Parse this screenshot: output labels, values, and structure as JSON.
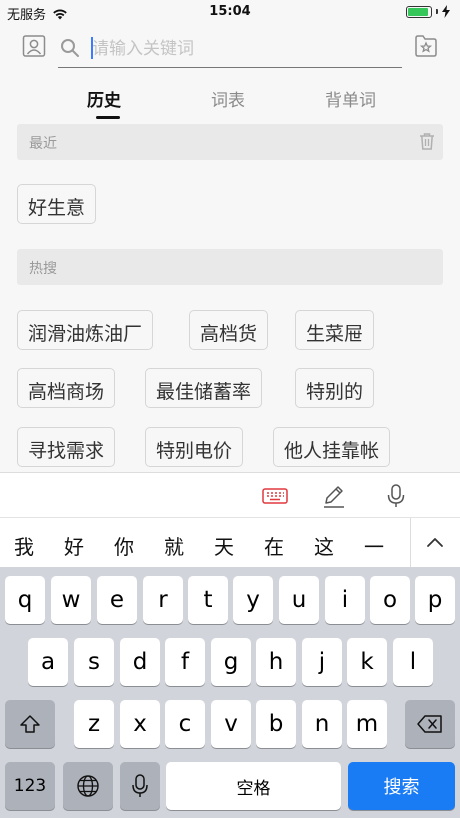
{
  "status": {
    "carrier": "无服务",
    "time": "15:04",
    "battery_level": 0.9,
    "battery_color": "#35c759"
  },
  "header": {
    "search_placeholder": "请输入关键词",
    "left_icon": "contact-card-icon",
    "right_icon": "favorites-icon",
    "search_icon": "search-icon"
  },
  "tabs": [
    {
      "label": "历史",
      "active": true
    },
    {
      "label": "词表",
      "active": false
    },
    {
      "label": "背单词",
      "active": false
    }
  ],
  "recent": {
    "title": "最近",
    "items": [
      "好生意"
    ]
  },
  "hot": {
    "title": "热搜",
    "items": [
      "润滑油炼油厂",
      "高档货",
      "生菜屉",
      "高档商场",
      "最佳储蓄率",
      "特别的",
      "寻找需求",
      "特别电价",
      "他人挂靠帐"
    ]
  },
  "toolbar": {
    "icons": [
      "keyboard-icon",
      "pencil-icon",
      "microphone-icon"
    ],
    "active_color": "#e0393e"
  },
  "candidates": [
    "我",
    "好",
    "你",
    "就",
    "天",
    "在",
    "这",
    "一"
  ],
  "keyboard": {
    "row1": [
      "q",
      "w",
      "e",
      "r",
      "t",
      "y",
      "u",
      "i",
      "o",
      "p"
    ],
    "row2": [
      "a",
      "s",
      "d",
      "f",
      "g",
      "h",
      "j",
      "k",
      "l"
    ],
    "row3": [
      "z",
      "x",
      "c",
      "v",
      "b",
      "n",
      "m"
    ],
    "numbers_label": "123",
    "space_label": "空格",
    "search_label": "搜索",
    "accent": "#1a7cf5"
  }
}
